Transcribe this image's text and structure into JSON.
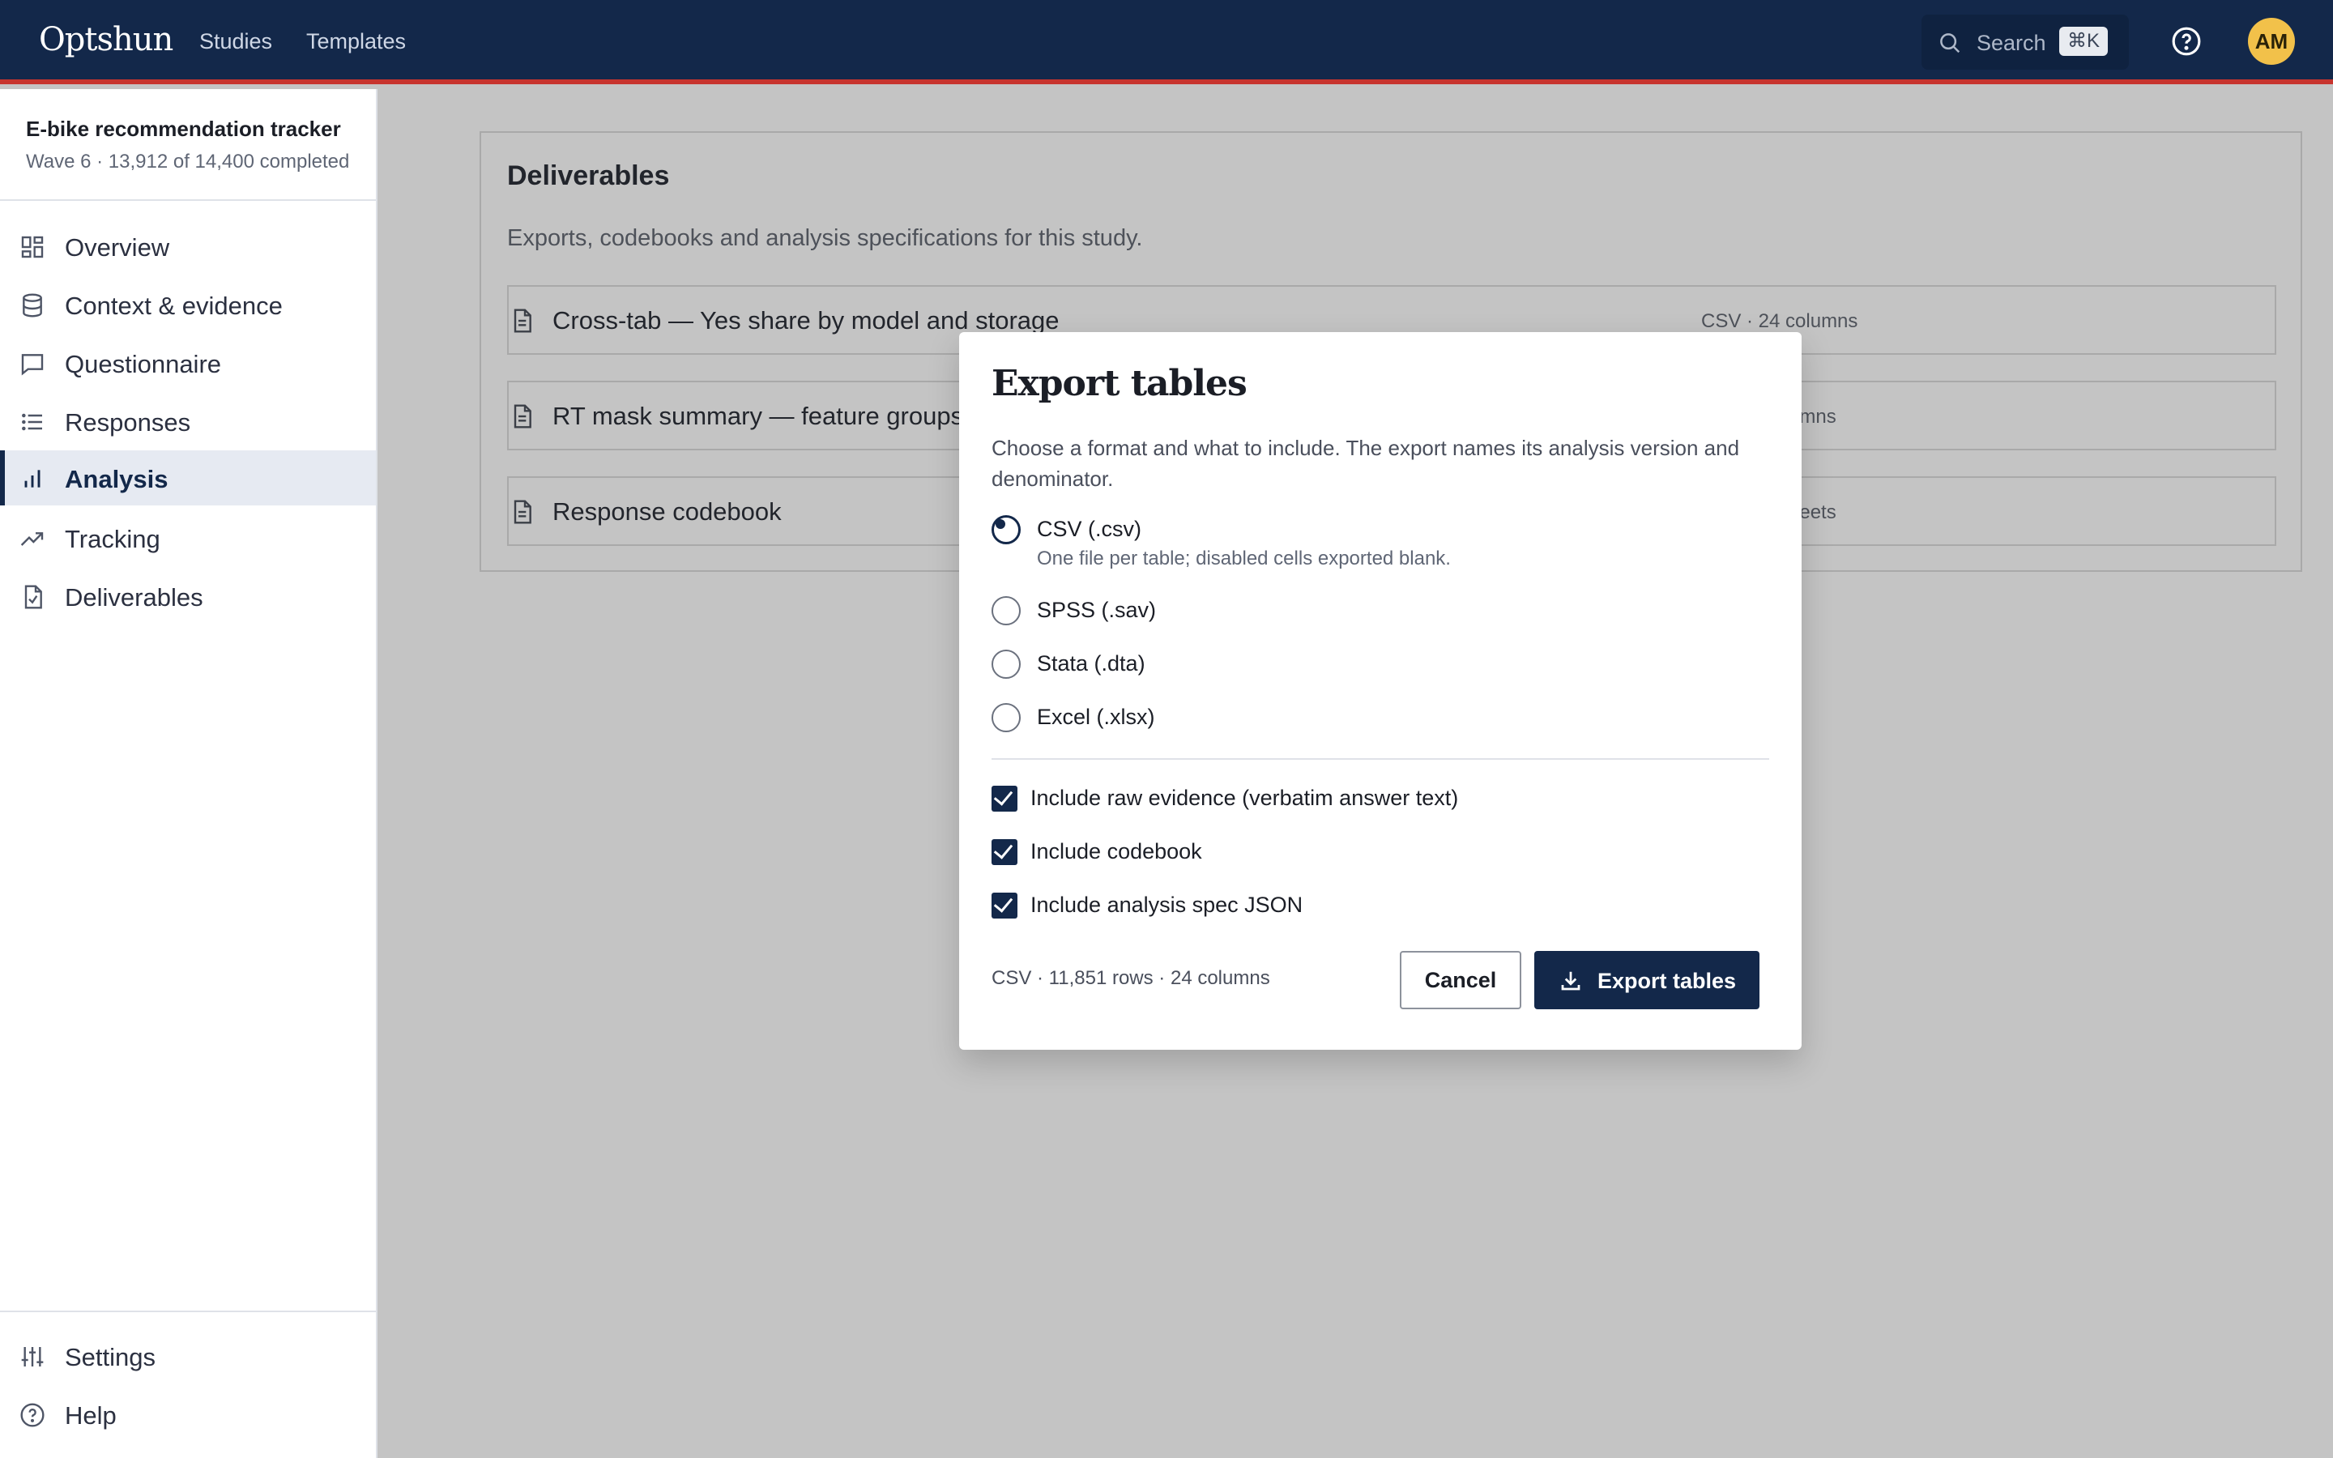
{
  "app": {
    "brand": "Optshun",
    "nav": [
      {
        "label": "Studies"
      },
      {
        "label": "Templates"
      }
    ],
    "search": {
      "label": "Search",
      "shortcut": "⌘K"
    },
    "user_initials": "AM",
    "accent_color": "#13284a",
    "brand_bar_color": "#c7342e"
  },
  "sidebar": {
    "study_title": "E-bike recommendation tracker",
    "study_subtitle": "Wave 6 · 13,912 of 14,400 completed",
    "items": [
      {
        "label": "Overview",
        "icon": "grid-icon"
      },
      {
        "label": "Context & evidence",
        "icon": "database-icon"
      },
      {
        "label": "Questionnaire",
        "icon": "message-icon"
      },
      {
        "label": "Responses",
        "icon": "list-icon"
      },
      {
        "label": "Analysis",
        "icon": "bar-chart-icon",
        "active": true
      },
      {
        "label": "Tracking",
        "icon": "trending-up-icon"
      },
      {
        "label": "Deliverables",
        "icon": "file-check-icon"
      }
    ],
    "footer_items": [
      {
        "label": "Settings",
        "icon": "sliders-icon"
      },
      {
        "label": "Help",
        "icon": "help-circle-icon"
      }
    ]
  },
  "main": {
    "title": "Deliverables",
    "subtitle": "Exports, codebooks and analysis specifications for this study.",
    "deliverables": [
      {
        "name": "Cross-tab — Yes share by model and storage",
        "meta": "CSV · 24 columns"
      },
      {
        "name": "RT mask summary — feature groups",
        "meta": "umns"
      },
      {
        "name": "Response codebook",
        "meta": "heets"
      }
    ]
  },
  "dialog": {
    "title": "Export tables",
    "description": "Choose a format and what to include. The export names its analysis version and denominator.",
    "formats": [
      {
        "label": "CSV (.csv)",
        "hint": "One file per table; disabled cells exported blank.",
        "selected": true
      },
      {
        "label": "SPSS (.sav)",
        "hint": "",
        "selected": false
      },
      {
        "label": "Stata (.dta)",
        "hint": "",
        "selected": false
      },
      {
        "label": "Excel (.xlsx)",
        "hint": "",
        "selected": false
      }
    ],
    "options": [
      {
        "label": "Include raw evidence (verbatim answer text)",
        "checked": true
      },
      {
        "label": "Include codebook",
        "checked": true
      },
      {
        "label": "Include analysis spec JSON",
        "checked": true
      }
    ],
    "summary": "CSV · 11,851 rows · 24 columns",
    "cancel_label": "Cancel",
    "export_label": "Export tables"
  }
}
